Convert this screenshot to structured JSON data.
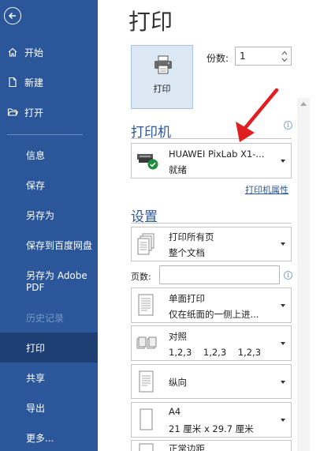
{
  "sidebar": {
    "items": [
      {
        "label": "开始"
      },
      {
        "label": "新建"
      },
      {
        "label": "打开"
      },
      {
        "label": "信息"
      },
      {
        "label": "保存"
      },
      {
        "label": "另存为"
      },
      {
        "label": "保存到百度网盘"
      },
      {
        "label": "另存为 Adobe\nPDF"
      },
      {
        "label": "历史记录"
      },
      {
        "label": "打印"
      },
      {
        "label": "共享"
      },
      {
        "label": "导出"
      },
      {
        "label": "更多..."
      }
    ]
  },
  "main": {
    "title": "打印",
    "print_button_label": "打印",
    "copies_label": "份数:",
    "copies_value": "1",
    "printer_section": "打印机",
    "printer": {
      "name": "HUAWEI PixLab X1-...",
      "status": "就绪"
    },
    "printer_properties_link": "打印机属性",
    "settings_section": "设置",
    "settings": [
      {
        "line1": "打印所有页",
        "line2": "整个文档"
      },
      {
        "line1": "单面打印",
        "line2": "仅在纸面的一侧上进..."
      },
      {
        "line1": "对照",
        "line2": "1,2,3    1,2,3    1,2,3"
      },
      {
        "line1": "纵向",
        "line2": ""
      },
      {
        "line1": "A4",
        "line2": "21 厘米 x 29.7 厘米"
      },
      {
        "line1": "正常边距",
        "line2": ""
      }
    ],
    "pages_label": "页数:",
    "pages_value": ""
  },
  "colors": {
    "sidebar_bg": "#2b579a",
    "sidebar_active": "#1e3f73",
    "accent": "#2b579a",
    "annotation_arrow": "#e02020"
  }
}
